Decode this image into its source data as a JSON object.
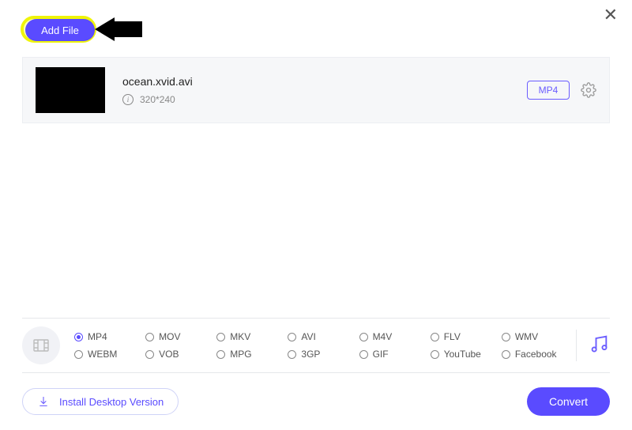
{
  "close_glyph": "✕",
  "toolbar": {
    "add_file_label": "Add File"
  },
  "file": {
    "name": "ocean.xvid.avi",
    "resolution": "320*240",
    "format_badge": "MP4"
  },
  "formats": {
    "selected": "MP4",
    "row1": [
      "MP4",
      "MOV",
      "MKV",
      "AVI",
      "M4V",
      "FLV",
      "WMV"
    ],
    "row2": [
      "WEBM",
      "VOB",
      "MPG",
      "3GP",
      "GIF",
      "YouTube",
      "Facebook"
    ]
  },
  "footer": {
    "install_label": "Install Desktop Version",
    "convert_label": "Convert"
  }
}
